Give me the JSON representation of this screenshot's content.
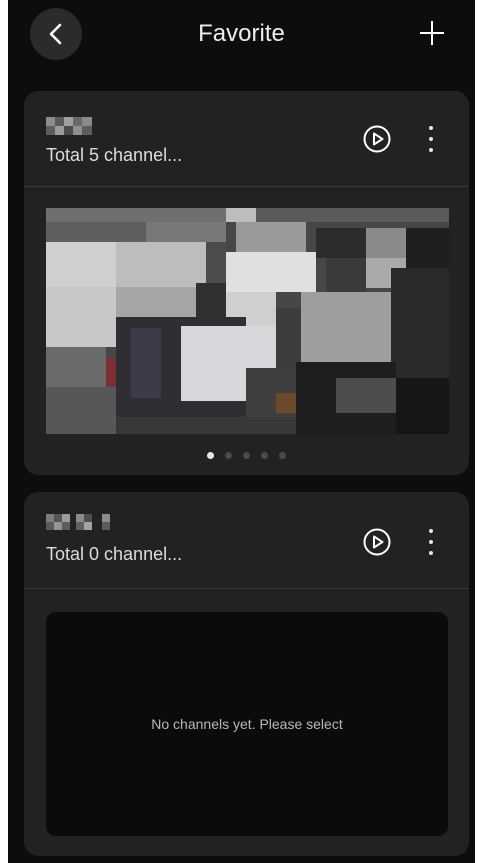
{
  "header": {
    "title": "Favorite",
    "back_icon": "chevron-left-icon",
    "add_icon": "plus-icon"
  },
  "groups": [
    {
      "name_redacted": true,
      "channel_count_label": "Total 5 channel...",
      "play_icon": "play-circle-icon",
      "more_icon": "more-vertical-icon",
      "pages": 5,
      "current_page": 1
    },
    {
      "name_redacted": true,
      "channel_count_label": "Total 0 channel...",
      "play_icon": "play-circle-icon",
      "more_icon": "more-vertical-icon",
      "empty_message": "No channels yet. Please select"
    }
  ],
  "colors": {
    "background": "#0d0d0d",
    "card": "#222222",
    "active_dot": "#e8e8e8",
    "inactive_dot": "#4a4a4a"
  }
}
